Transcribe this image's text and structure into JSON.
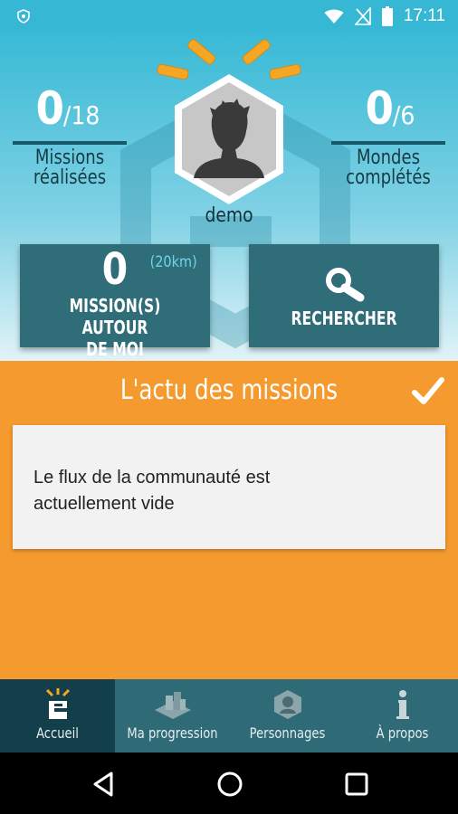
{
  "status_bar": {
    "time": "17:11"
  },
  "stats": {
    "missions": {
      "value": "0",
      "total": "/18",
      "caption_line1": "Missions",
      "caption_line2": "réalisées"
    },
    "worlds": {
      "value": "0",
      "total": "/6",
      "caption_line1": "Mondes",
      "caption_line2": "complétés"
    }
  },
  "profile": {
    "username": "demo"
  },
  "tiles": {
    "around": {
      "count": "0",
      "radius": "(20km)",
      "label_line1": "MISSION(S) AUTOUR",
      "label_line2": "DE MOI"
    },
    "search": {
      "label": "RECHERCHER"
    }
  },
  "feed": {
    "title": "L'actu des missions",
    "empty_message_line1": "Le flux de la communauté est",
    "empty_message_line2": "actuellement vide"
  },
  "tabs": [
    {
      "label": "Accueil",
      "icon": "home-e-icon",
      "active": true
    },
    {
      "label": "Ma progression",
      "icon": "city-icon",
      "active": false
    },
    {
      "label": "Personnages",
      "icon": "character-icon",
      "active": false
    },
    {
      "label": "À propos",
      "icon": "info-icon",
      "active": false
    }
  ],
  "colors": {
    "header_top": "#39bad6",
    "tile": "#2f6d78",
    "panel": "#f49a2e",
    "tabbar": "#2e6b76",
    "tab_active": "#123f4a"
  }
}
